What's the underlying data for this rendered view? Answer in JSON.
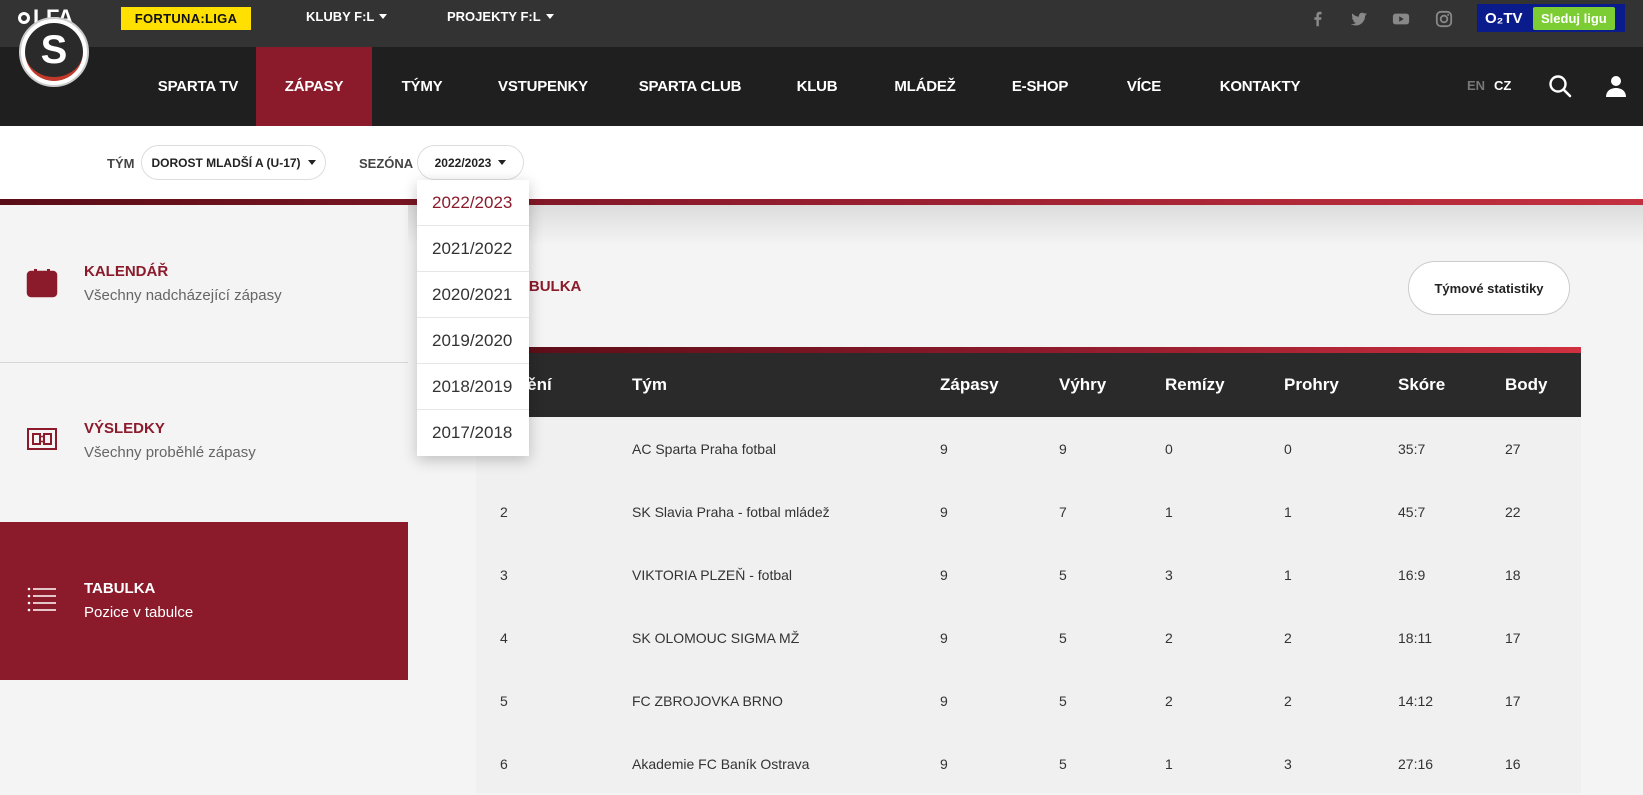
{
  "topbar": {
    "lfa_logo": "LFA",
    "fortuna": "FORTUNA:LIGA",
    "kluby": "KLUBY F:L",
    "projekty": "PROJEKTY F:L",
    "social_icons": [
      "facebook-icon",
      "twitter-icon",
      "youtube-icon",
      "instagram-icon"
    ],
    "o2_tv": "O₂TV",
    "o2_button": "Sleduj ligu"
  },
  "nav": {
    "club_logo": "S",
    "items": [
      "SPARTA TV",
      "ZÁPASY",
      "TÝMY",
      "VSTUPENKY",
      "SPARTA CLUB",
      "KLUB",
      "MLÁDEŽ",
      "E-SHOP",
      "VÍCE",
      "KONTAKTY"
    ],
    "active_item": "ZÁPASY",
    "lang_en": "EN",
    "lang_cz": "CZ"
  },
  "filters": {
    "team_label": "TÝM",
    "team_value": "DOROST MLADŠÍ A (U-17)",
    "season_label": "SEZÓNA",
    "season_value": "2022/2023"
  },
  "season_dropdown": {
    "options": [
      "2022/2023",
      "2021/2022",
      "2020/2021",
      "2019/2020",
      "2018/2019",
      "2017/2018"
    ],
    "selected": "2022/2023"
  },
  "sidebar": {
    "items": [
      {
        "title": "KALENDÁŘ",
        "subtitle": "Všechny nadcházející zápasy",
        "icon": "calendar-icon"
      },
      {
        "title": "VÝSLEDKY",
        "subtitle": "Všechny proběhlé zápasy",
        "icon": "scoreboard-icon"
      },
      {
        "title": "TABULKA",
        "subtitle": "Pozice v tabulce",
        "icon": "list-icon"
      }
    ],
    "active_index": 2
  },
  "content": {
    "section_title_visible": "TABULKA",
    "stats_button": "Týmové statistiky",
    "table": {
      "headers": [
        "stění",
        "Tým",
        "Zápasy",
        "Výhry",
        "Remízy",
        "Prohry",
        "Skóre",
        "Body"
      ],
      "rows": [
        [
          "",
          "AC Sparta Praha fotbal",
          "9",
          "9",
          "0",
          "0",
          "35:7",
          "27"
        ],
        [
          "2",
          "SK Slavia Praha - fotbal mládež",
          "9",
          "7",
          "1",
          "1",
          "45:7",
          "22"
        ],
        [
          "3",
          "VIKTORIA PLZEŇ - fotbal",
          "9",
          "5",
          "3",
          "1",
          "16:9",
          "18"
        ],
        [
          "4",
          "SK OLOMOUC SIGMA MŽ",
          "9",
          "5",
          "2",
          "2",
          "18:11",
          "17"
        ],
        [
          "5",
          "FC ZBROJOVKA BRNO",
          "9",
          "5",
          "2",
          "2",
          "14:12",
          "17"
        ],
        [
          "6",
          "Akademie FC Baník Ostrava",
          "9",
          "5",
          "1",
          "3",
          "27:16",
          "16"
        ]
      ]
    }
  },
  "colors": {
    "brand": "#8b1a2b",
    "topbar": "#333333",
    "nav": "#1f1f1f",
    "table_header": "#2a2a2a",
    "fortuna_yellow": "#ffe000",
    "o2_blue": "#0a1b8c",
    "o2_green": "#7ccc33"
  }
}
